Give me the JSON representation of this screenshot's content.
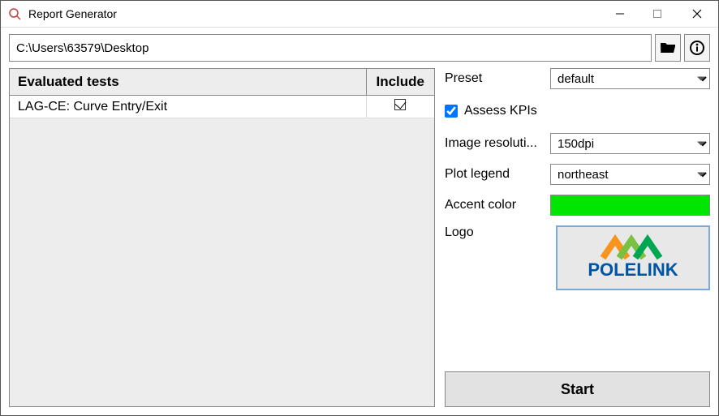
{
  "window": {
    "title": "Report Generator"
  },
  "pathbar": {
    "path": "C:\\Users\\63579\\Desktop"
  },
  "tests_table": {
    "header_name": "Evaluated tests",
    "header_include": "Include",
    "rows": [
      {
        "name": "LAG-CE: Curve Entry/Exit",
        "included": true
      }
    ]
  },
  "settings": {
    "preset_label": "Preset",
    "preset_value": "default",
    "assess_kpis_label": "Assess KPIs",
    "assess_kpis_checked": true,
    "image_res_label": "Image resoluti...",
    "image_res_value": "150dpi",
    "plot_legend_label": "Plot legend",
    "plot_legend_value": "northeast",
    "accent_color_label": "Accent color",
    "accent_color_value": "#00e600",
    "logo_label": "Logo",
    "logo_text": "POLELINK"
  },
  "buttons": {
    "start": "Start"
  }
}
